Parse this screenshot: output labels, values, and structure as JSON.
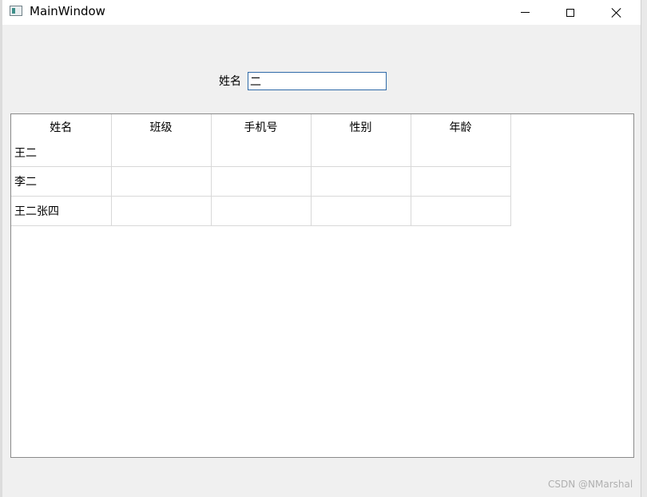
{
  "window": {
    "title": "MainWindow"
  },
  "form": {
    "name_label": "姓名",
    "name_value": "二"
  },
  "table": {
    "columns": [
      "姓名",
      "班级",
      "手机号",
      "性别",
      "年龄"
    ],
    "rows": [
      [
        "王二",
        "",
        "",
        "",
        ""
      ],
      [
        "李二",
        "",
        "",
        "",
        ""
      ],
      [
        "王二张四",
        "",
        "",
        "",
        ""
      ]
    ]
  },
  "watermark": "CSDN @NMarshal"
}
